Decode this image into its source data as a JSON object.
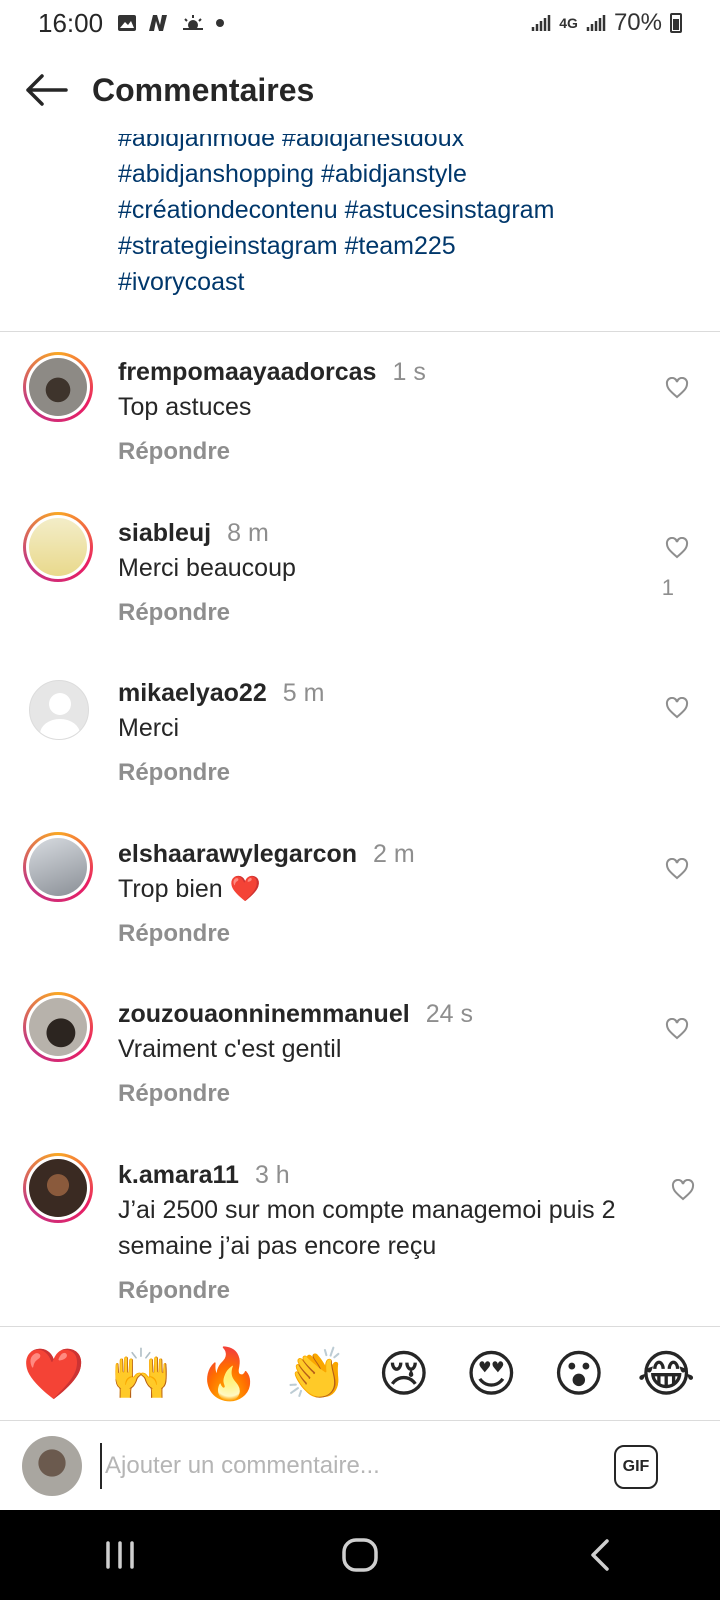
{
  "status_bar": {
    "time": "16:00",
    "network": "4G",
    "battery": "70%"
  },
  "header": {
    "title": "Commentaires"
  },
  "caption": {
    "lines": [
      "#abidjanmode #abidjanestdoux",
      "#abidjanshopping #abidjanstyle",
      "#créationdecontenu #astucesinstagram",
      "#strategieinstagram #team225",
      "#ivorycoast"
    ]
  },
  "comments": [
    {
      "username": "frempomaayaadorcas",
      "time": "1 s",
      "text": "Top astuces",
      "reply": "Répondre",
      "likes": ""
    },
    {
      "username": "siableuj",
      "time": "8 m",
      "text": "Merci beaucoup",
      "reply": "Répondre",
      "likes": "1"
    },
    {
      "username": "mikaelyao22",
      "time": "5 m",
      "text": "Merci",
      "reply": "Répondre",
      "likes": ""
    },
    {
      "username": "elshaarawylegarcon",
      "time": "2 m",
      "text": "Trop bien ❤️",
      "reply": "Répondre",
      "likes": ""
    },
    {
      "username": "zouzouaonninemmanuel",
      "time": "24 s",
      "text": "Vraiment c'est gentil",
      "reply": "Répondre",
      "likes": ""
    },
    {
      "username": "k.amara11",
      "time": "3 h",
      "text": "J’ai 2500 sur mon compte managemoi puis 2 semaine j’ai pas encore reçu",
      "reply": "Répondre",
      "likes": ""
    }
  ],
  "emoji_bar": [
    "❤️",
    "🙌",
    "🔥",
    "👏",
    "😢",
    "😍",
    "😮",
    "😂"
  ],
  "input": {
    "placeholder": "Ajouter un commentaire...",
    "gif_label": "GIF"
  },
  "colors": {
    "hashtag": "#00376b",
    "muted": "#8e8e8e",
    "text": "#262626"
  }
}
